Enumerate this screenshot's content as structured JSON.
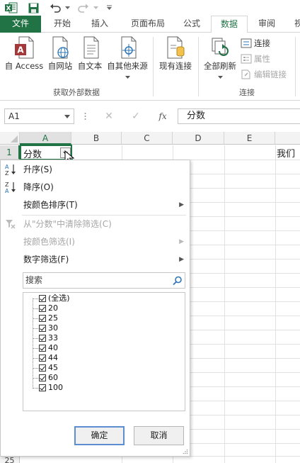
{
  "titlebar": {
    "app_icon": "excel-icon",
    "save_icon": "save-icon",
    "undo_icon": "undo-icon",
    "redo_icon": "redo-icon"
  },
  "tabs": [
    {
      "label": "文件"
    },
    {
      "label": "开始"
    },
    {
      "label": "插入"
    },
    {
      "label": "页面布局"
    },
    {
      "label": "公式"
    },
    {
      "label": "数据"
    },
    {
      "label": "审阅"
    },
    {
      "label": "视"
    }
  ],
  "ribbon": {
    "get_external": {
      "buttons": [
        {
          "label": "自 Access"
        },
        {
          "label": "自网站"
        },
        {
          "label": "自文本"
        },
        {
          "label": "自其他来源"
        }
      ],
      "group_label": "获取外部数据"
    },
    "existing_conn": {
      "label": "现有连接"
    },
    "refresh_all": {
      "label": "全部刷新"
    },
    "connections": {
      "items": [
        {
          "label": "连接"
        },
        {
          "label": "属性"
        },
        {
          "label": "编辑链接"
        }
      ],
      "group_label": "连接"
    }
  },
  "formula_bar": {
    "name_box": "A1",
    "cancel_symbol": "✕",
    "enter_symbol": "✓",
    "fx_symbol": "fx",
    "content": "分数"
  },
  "grid": {
    "columns": [
      "A",
      "B",
      "C",
      "D",
      "E"
    ],
    "rows": [
      "1",
      "25"
    ],
    "a1": "分数",
    "f1": "我们"
  },
  "filter_menu": {
    "sort_asc": "升序(S)",
    "sort_desc": "降序(O)",
    "sort_by_color": "按颜色排序(T)",
    "clear_filter": "从\"分数\"中清除筛选(C)",
    "filter_by_color": "按颜色筛选(I)",
    "number_filter": "数字筛选(F)",
    "search_placeholder": "搜索",
    "values": [
      "(全选)",
      "20",
      "25",
      "30",
      "33",
      "40",
      "44",
      "45",
      "60",
      "100"
    ],
    "ok": "确定",
    "cancel": "取消"
  },
  "colors": {
    "accent": "#217346",
    "primary_button_border": "#5b8fd1"
  }
}
